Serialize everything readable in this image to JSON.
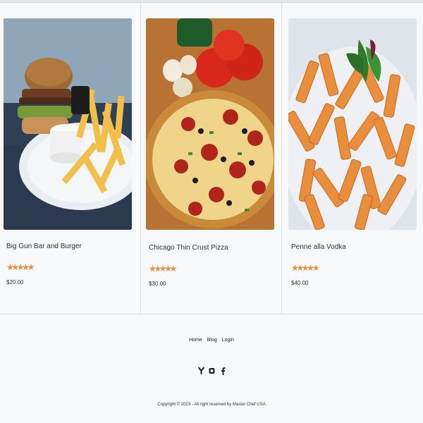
{
  "items": [
    {
      "name": "Big Gun Bar and Burger",
      "price": "$20.00",
      "rating": 5,
      "image": "burger-and-fries-photo"
    },
    {
      "name": "Chicago Thin Crust Pizza",
      "price": "$30.00",
      "rating": 5,
      "image": "pizza-photo"
    },
    {
      "name": "Penne alla Vodka",
      "price": "$40.00",
      "rating": 5,
      "image": "penne-pasta-photo"
    }
  ],
  "footer": {
    "nav": [
      "Home",
      "Blog",
      "Login"
    ],
    "social_icons": [
      "youtube-icon",
      "instagram-icon",
      "facebook-icon"
    ],
    "copyright": "Copyright © 2023 - All right reserved by Master Chef USA"
  },
  "colors": {
    "star": "#f08a3c",
    "background": "#f7f8fa"
  }
}
